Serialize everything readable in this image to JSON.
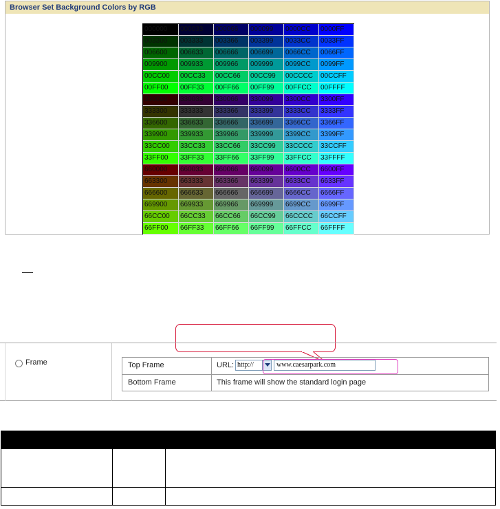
{
  "color_panel": {
    "title": "Browser Set Background Colors by RGB",
    "rows": [
      [
        "000000",
        "000033",
        "000066",
        "000099",
        "0000CC",
        "0000FF"
      ],
      [
        "003300",
        "003333",
        "003366",
        "003399",
        "0033CC",
        "0033FF"
      ],
      [
        "006600",
        "006633",
        "006666",
        "006699",
        "0066CC",
        "0066FF"
      ],
      [
        "009900",
        "009933",
        "009966",
        "009999",
        "0099CC",
        "0099FF"
      ],
      [
        "00CC00",
        "00CC33",
        "00CC66",
        "00CC99",
        "00CCCC",
        "00CCFF"
      ],
      [
        "00FF00",
        "00FF33",
        "00FF66",
        "00FF99",
        "00FFCC",
        "00FFFF"
      ],
      [
        "330000",
        "330033",
        "330066",
        "330099",
        "3300CC",
        "3300FF"
      ],
      [
        "333300",
        "333333",
        "333366",
        "333399",
        "3333CC",
        "3333FF"
      ],
      [
        "336600",
        "336633",
        "336666",
        "336699",
        "3366CC",
        "3366FF"
      ],
      [
        "339900",
        "339933",
        "339966",
        "339999",
        "3399CC",
        "3399FF"
      ],
      [
        "33CC00",
        "33CC33",
        "33CC66",
        "33CC99",
        "33CCCC",
        "33CCFF"
      ],
      [
        "33FF00",
        "33FF33",
        "33FF66",
        "33FF99",
        "33FFCC",
        "33FFFF"
      ],
      [
        "660000",
        "660033",
        "660066",
        "660099",
        "6600CC",
        "6600FF"
      ],
      [
        "663300",
        "663333",
        "663366",
        "663399",
        "6633CC",
        "6633FF"
      ],
      [
        "666600",
        "666633",
        "666666",
        "666699",
        "6666CC",
        "6666FF"
      ],
      [
        "669900",
        "669933",
        "669966",
        "669999",
        "6699CC",
        "6699FF"
      ],
      [
        "66CC00",
        "66CC33",
        "66CC66",
        "66CC99",
        "66CCCC",
        "66CCFF"
      ],
      [
        "66FF00",
        "66FF33",
        "66FF66",
        "66FF99",
        "66FFCC",
        "66FFFF"
      ]
    ]
  },
  "frame_config": {
    "option_label": "Frame",
    "top_frame_label": "Top Frame",
    "url_label": "URL:",
    "protocol_value": "http://",
    "url_value": "www.caesarpark.com",
    "bottom_frame_label": "Bottom Frame",
    "bottom_frame_text": "This frame will show the standard login page"
  },
  "colors": {
    "panel_title_bg": "#efe5b7",
    "panel_title_text": "#1f3a78",
    "callout_border": "#d7183a",
    "url_highlight": "#e040c0"
  }
}
